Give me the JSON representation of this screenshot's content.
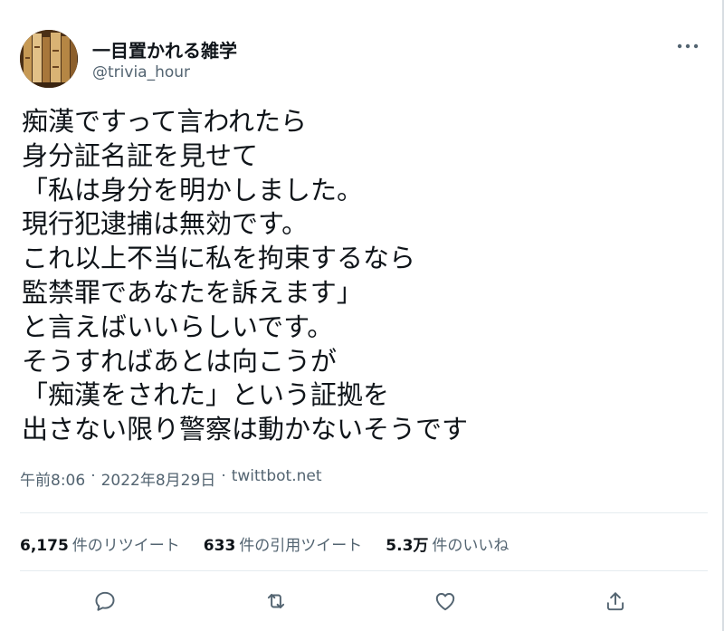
{
  "author": {
    "display_name": "一目置かれる雑学",
    "handle": "@trivia_hour"
  },
  "tweet": {
    "lines": [
      "痴漢ですって言われたら",
      "身分証名証を見せて",
      "「私は身分を明かしました。",
      "現行犯逮捕は無効です。",
      "これ以上不当に私を拘束するなら",
      "監禁罪であなたを訴えます」",
      "と言えばいいらしいです。",
      "そうすればあとは向こうが",
      "「痴漢をされた」という証拠を",
      "出さない限り警察は動かないそうです"
    ],
    "time": "午前8:06",
    "date": "2022年8月29日",
    "separator": "·",
    "source": "twittbot.net"
  },
  "stats": {
    "retweets": {
      "count": "6,175",
      "label": "件のリツイート"
    },
    "quotes": {
      "count": "633",
      "label": "件の引用ツイート"
    },
    "likes": {
      "count": "5.3万",
      "label": "件のいいね"
    }
  },
  "icons": {
    "more": "more-dots-icon",
    "reply": "reply-bubble-icon",
    "retweet": "retweet-arrows-icon",
    "like": "heart-icon",
    "share": "share-upload-icon"
  },
  "colors": {
    "text": "#0f1419",
    "secondary": "#536471",
    "divider": "#e6ecf0"
  }
}
